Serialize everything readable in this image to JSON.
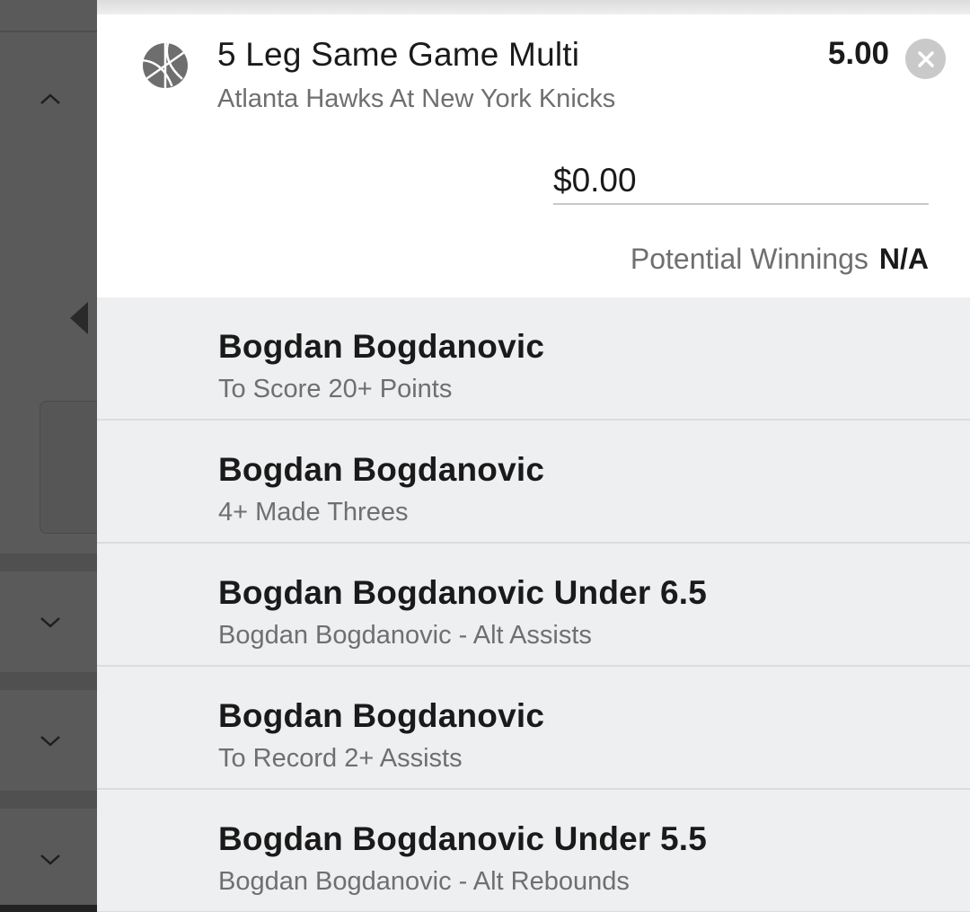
{
  "bet": {
    "icon": "basketball-icon",
    "title": "5 Leg Same Game Multi",
    "subtitle": "Atlanta Hawks At New York Knicks",
    "odds": "5.00",
    "stake_value": "$0.00",
    "potential_winnings_label": "Potential Winnings",
    "potential_winnings_value": "N/A"
  },
  "legs": [
    {
      "name": "Bogdan Bogdanovic",
      "desc": "To Score 20+ Points"
    },
    {
      "name": "Bogdan Bogdanovic",
      "desc": "4+ Made Threes"
    },
    {
      "name": "Bogdan Bogdanovic Under 6.5",
      "desc": "Bogdan Bogdanovic - Alt Assists"
    },
    {
      "name": "Bogdan Bogdanovic",
      "desc": "To Record 2+ Assists"
    },
    {
      "name": "Bogdan Bogdanovic Under 5.5",
      "desc": "Bogdan Bogdanovic - Alt Rebounds"
    }
  ],
  "left_strip": {
    "icons": [
      "chevron-up-icon",
      "collapse-arrow-icon",
      "chevron-down-icon",
      "chevron-down-icon",
      "chevron-down-icon"
    ]
  },
  "colors": {
    "panel_bg": "#eeeff1",
    "card_bg": "#ffffff",
    "text_primary": "#1a1a1a",
    "text_secondary": "#6f6f6f",
    "overlay": "#5a5a5a"
  }
}
